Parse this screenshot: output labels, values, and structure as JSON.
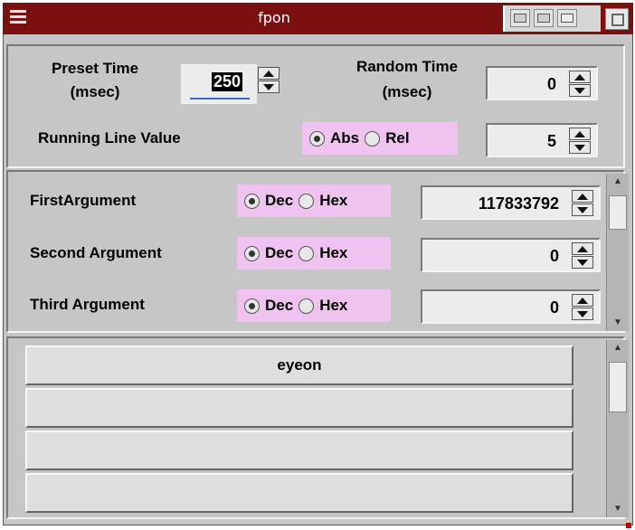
{
  "window": {
    "title": "fpon"
  },
  "timing": {
    "preset_label_1": "Preset Time",
    "preset_label_2": "(msec)",
    "preset_value": "250",
    "random_label_1": "Random Time",
    "random_label_2": "(msec)",
    "random_value": "0",
    "running_label": "Running Line Value",
    "mode_abs": "Abs",
    "mode_rel": "Rel",
    "mode_selected": "Abs",
    "running_value": "5"
  },
  "arguments": [
    {
      "label": "FirstArgument",
      "dec": "Dec",
      "hex": "Hex",
      "selected": "Dec",
      "value": "117833792"
    },
    {
      "label": "Second Argument",
      "dec": "Dec",
      "hex": "Hex",
      "selected": "Dec",
      "value": "0"
    },
    {
      "label": "Third Argument",
      "dec": "Dec",
      "hex": "Hex",
      "selected": "Dec",
      "value": "0"
    }
  ],
  "buttons": [
    {
      "label": "eyeon"
    },
    {
      "label": ""
    },
    {
      "label": ""
    },
    {
      "label": ""
    }
  ],
  "colors": {
    "titlebar": "#7a1010",
    "radio_group_bg": "#f0c2f0",
    "panel_bg": "#c6c6c6"
  }
}
